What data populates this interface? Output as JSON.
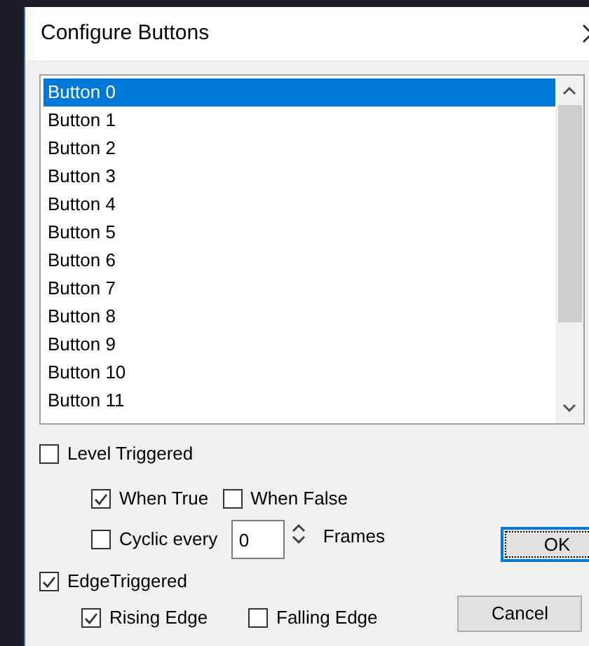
{
  "window": {
    "title": "Configure Buttons"
  },
  "buttons_list": [
    {
      "label": "Button 0",
      "selected": true
    },
    {
      "label": "Button 1",
      "selected": false
    },
    {
      "label": "Button 2",
      "selected": false
    },
    {
      "label": "Button 3",
      "selected": false
    },
    {
      "label": "Button 4",
      "selected": false
    },
    {
      "label": "Button 5",
      "selected": false
    },
    {
      "label": "Button 6",
      "selected": false
    },
    {
      "label": "Button 7",
      "selected": false
    },
    {
      "label": "Button 8",
      "selected": false
    },
    {
      "label": "Button 9",
      "selected": false
    },
    {
      "label": "Button 10",
      "selected": false
    },
    {
      "label": "Button 11",
      "selected": false
    }
  ],
  "level_triggered": {
    "label": "Level Triggered",
    "checked": false
  },
  "when_true": {
    "label": "When True",
    "checked": true
  },
  "when_false": {
    "label": "When False",
    "checked": false
  },
  "cyclic_every": {
    "label": "Cyclic every",
    "checked": false
  },
  "frames_field": {
    "value": "0",
    "unit": "Frames"
  },
  "edge_triggered": {
    "label": "EdgeTriggered",
    "checked": true
  },
  "rising_edge": {
    "label": "Rising Edge",
    "checked": true
  },
  "falling_edge": {
    "label": "Falling Edge",
    "checked": false
  },
  "ok_button": {
    "label": "OK"
  },
  "cancel_button": {
    "label": "Cancel"
  }
}
